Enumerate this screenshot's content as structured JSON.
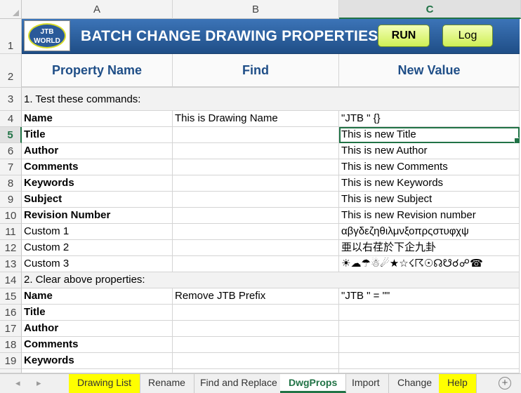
{
  "columns": {
    "a": "A",
    "b": "B",
    "c": "C"
  },
  "banner": {
    "logo_line1": "JTB",
    "logo_line2": "WORLD",
    "title": "BATCH CHANGE DRAWING PROPERTIES",
    "run_label": "RUN",
    "log_label": "Log"
  },
  "headers": {
    "property": "Property Name",
    "find": "Find",
    "new_value": "New Value"
  },
  "row_numbers": [
    "1",
    "2",
    "3",
    "4",
    "5",
    "6",
    "7",
    "8",
    "9",
    "10",
    "11",
    "12",
    "13",
    "14",
    "15",
    "16",
    "17",
    "18",
    "19"
  ],
  "rows": {
    "r3": {
      "a": "1. Test these commands:"
    },
    "r4": {
      "a": "Name",
      "b": "This is Drawing Name",
      "c": "\"JTB \" {}"
    },
    "r5": {
      "a": "Title",
      "c": "This is new Title"
    },
    "r6": {
      "a": "Author",
      "c": "This is new Author"
    },
    "r7": {
      "a": "Comments",
      "c": "This is new Comments"
    },
    "r8": {
      "a": "Keywords",
      "c": "This is new Keywords"
    },
    "r9": {
      "a": "Subject",
      "c": "This is new Subject"
    },
    "r10": {
      "a": "Revision Number",
      "c": "This is new Revision number"
    },
    "r11": {
      "a": "Custom 1",
      "c": "αβγδεζηθιλμνξοπρςστυφχψ"
    },
    "r12": {
      "a": "Custom 2",
      "c": "亜以右荏於下企九卦"
    },
    "r13": {
      "a": "Custom 3",
      "c": "☀☁☂☃☄★☆☇☈☉☊☋☌☍☎"
    },
    "r14": {
      "a": "2. Clear above properties:"
    },
    "r15": {
      "a": "Name",
      "b": "Remove JTB Prefix",
      "c": "\"JTB \" = \"\""
    },
    "r16": {
      "a": "Title"
    },
    "r17": {
      "a": "Author"
    },
    "r18": {
      "a": "Comments"
    },
    "r19": {
      "a": "Keywords"
    }
  },
  "tabs": {
    "prev": "◂",
    "next": "▸",
    "drawing_list": "Drawing List",
    "rename": "Rename",
    "find_replace": "Find and Replace",
    "dwgprops": "DwgProps",
    "import": "Import",
    "change": "Change",
    "help": "Help",
    "add": "+"
  },
  "colors": {
    "accent": "#217346",
    "banner": "#1f4e87",
    "button": "#d9f26b",
    "tab_highlight": "#ffff00"
  }
}
